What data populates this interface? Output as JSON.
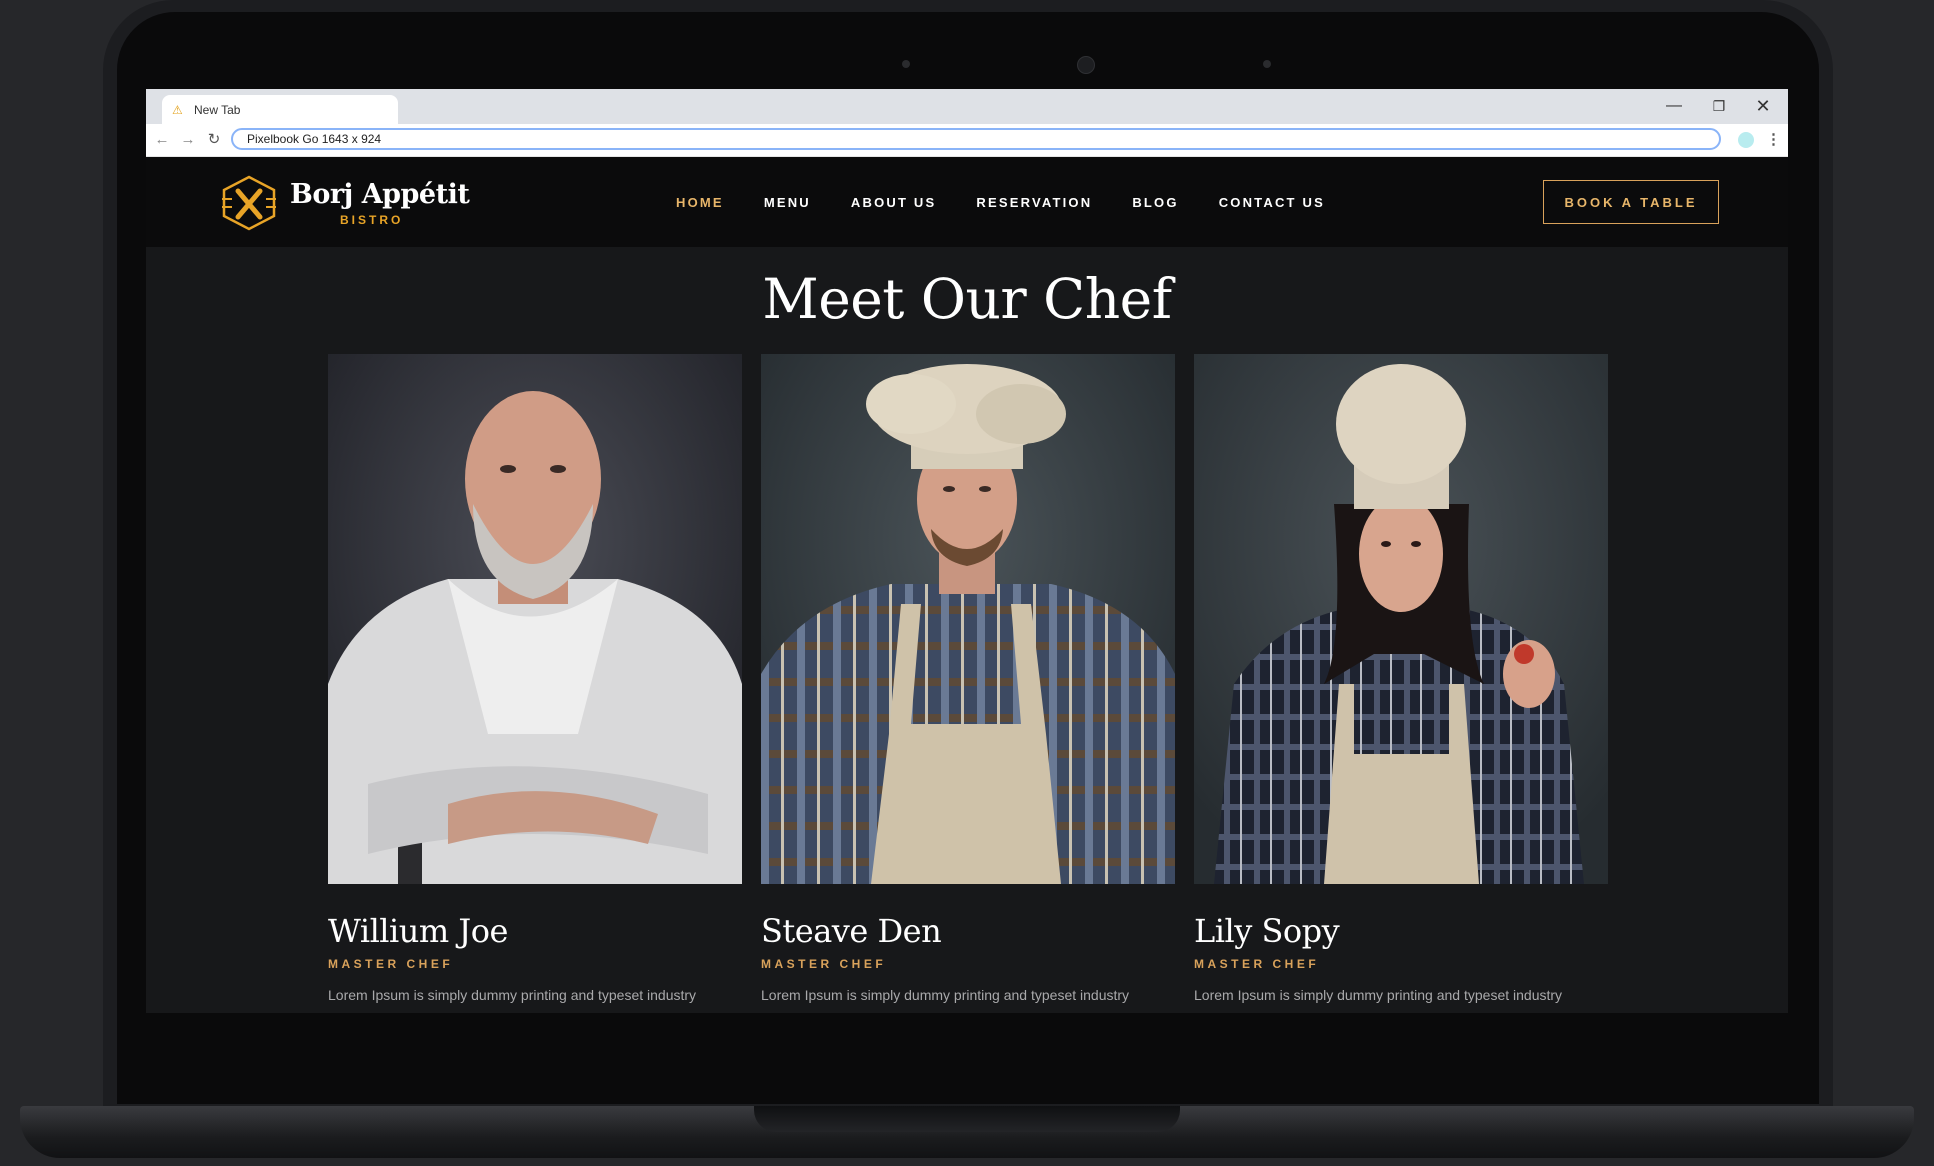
{
  "browser": {
    "tab_title": "New Tab",
    "address": "Pixelbook Go  1643 x 924"
  },
  "site": {
    "logo_name": "Borj Appétit",
    "logo_sub": "BISTRO",
    "nav": [
      {
        "label": "HOME",
        "active": true
      },
      {
        "label": "MENU",
        "active": false
      },
      {
        "label": "ABOUT US",
        "active": false
      },
      {
        "label": "RESERVATION",
        "active": false
      },
      {
        "label": "BLOG",
        "active": false
      },
      {
        "label": "CONTACT US",
        "active": false
      }
    ],
    "cta_label": "BOOK A TABLE",
    "accent_color": "#e8b66a"
  },
  "section": {
    "title": "Meet Our Chef",
    "chefs": [
      {
        "name": "Willium Joe",
        "role": "MASTER CHEF",
        "desc": "Lorem Ipsum is simply dummy printing and typeset industry"
      },
      {
        "name": "Steave Den",
        "role": "MASTER CHEF",
        "desc": "Lorem Ipsum is simply dummy printing and typeset industry"
      },
      {
        "name": "Lily Sopy",
        "role": "MASTER CHEF",
        "desc": "Lorem Ipsum is simply dummy printing and typeset industry"
      }
    ]
  }
}
